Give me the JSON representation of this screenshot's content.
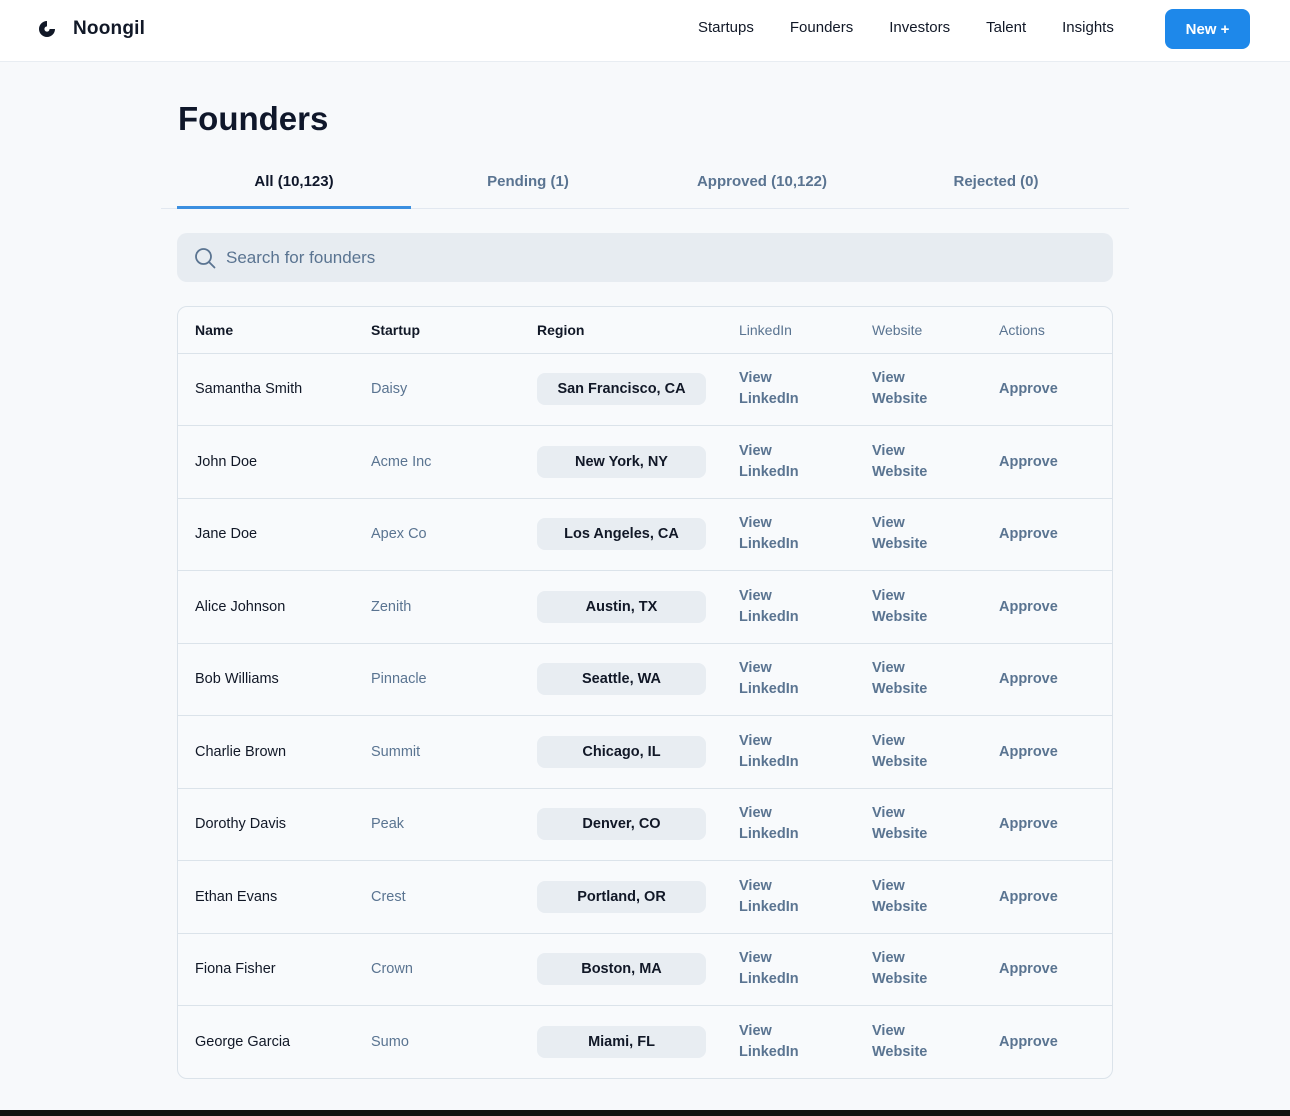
{
  "app": {
    "name": "Noongil",
    "logo_icon": "crescent-logo-icon"
  },
  "nav": {
    "items": [
      "Startups",
      "Founders",
      "Investors",
      "Talent",
      "Insights"
    ],
    "new_button": "New +"
  },
  "page": {
    "title": "Founders"
  },
  "tabs": [
    {
      "label": "All (10,123)",
      "active": true
    },
    {
      "label": "Pending (1)",
      "active": false
    },
    {
      "label": "Approved (10,122)",
      "active": false
    },
    {
      "label": "Rejected (0)",
      "active": false
    }
  ],
  "search": {
    "placeholder": "Search for founders",
    "value": "",
    "icon": "search-icon"
  },
  "table": {
    "columns": [
      "Name",
      "Startup",
      "Region",
      "LinkedIn",
      "Website",
      "Actions"
    ],
    "linkedin_label": "View LinkedIn",
    "website_label": "View Website",
    "action_label": "Approve",
    "rows": [
      {
        "name": "Samantha Smith",
        "startup": "Daisy",
        "region": "San Francisco, CA"
      },
      {
        "name": "John Doe",
        "startup": "Acme Inc",
        "region": "New York, NY"
      },
      {
        "name": "Jane Doe",
        "startup": "Apex Co",
        "region": "Los Angeles, CA"
      },
      {
        "name": "Alice Johnson",
        "startup": "Zenith",
        "region": "Austin, TX"
      },
      {
        "name": "Bob Williams",
        "startup": "Pinnacle",
        "region": "Seattle, WA"
      },
      {
        "name": "Charlie Brown",
        "startup": "Summit",
        "region": "Chicago, IL"
      },
      {
        "name": "Dorothy Davis",
        "startup": "Peak",
        "region": "Denver, CO"
      },
      {
        "name": "Ethan Evans",
        "startup": "Crest",
        "region": "Portland, OR"
      },
      {
        "name": "Fiona Fisher",
        "startup": "Crown",
        "region": "Boston, MA"
      },
      {
        "name": "George Garcia",
        "startup": "Sumo",
        "region": "Miami, FL"
      }
    ]
  },
  "colors": {
    "accent": "#1e88ea",
    "muted_text": "#5a7491",
    "tab_underline": "#3b8fe0"
  }
}
